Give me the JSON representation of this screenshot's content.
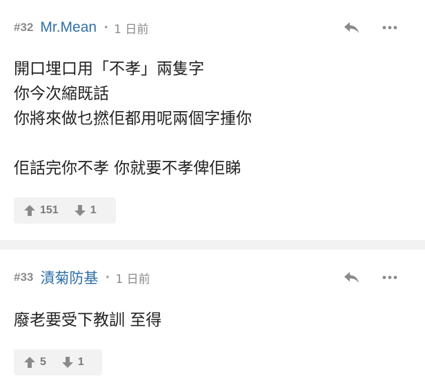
{
  "comments": [
    {
      "floor": "#32",
      "author": "Mr.Mean",
      "separator": "•",
      "time": "1 日前",
      "lines": [
        "開口埋口用「不孝」兩隻字",
        "你今次縮既話",
        "你將來做乜撚佢都用呢兩個字揰你",
        "",
        "佢話完你不孝 你就要不孝俾佢睇"
      ],
      "upvotes": "151",
      "downvotes": "1"
    },
    {
      "floor": "#33",
      "author": "漬菊防基",
      "separator": "•",
      "time": "1 日前",
      "lines": [
        "廢老要受下教訓 至得"
      ],
      "upvotes": "5",
      "downvotes": "1"
    }
  ],
  "icons": {
    "reply": "reply-arrow-icon",
    "more": "more-dots-icon",
    "upvote": "thumb-up-arrow-icon",
    "downvote": "thumb-down-arrow-icon"
  },
  "colors": {
    "author": "#2e6fa7",
    "meta": "#8a8a8a",
    "body": "#222222",
    "vote_bg": "#f2f2f2",
    "icon": "#8a8a8a"
  }
}
